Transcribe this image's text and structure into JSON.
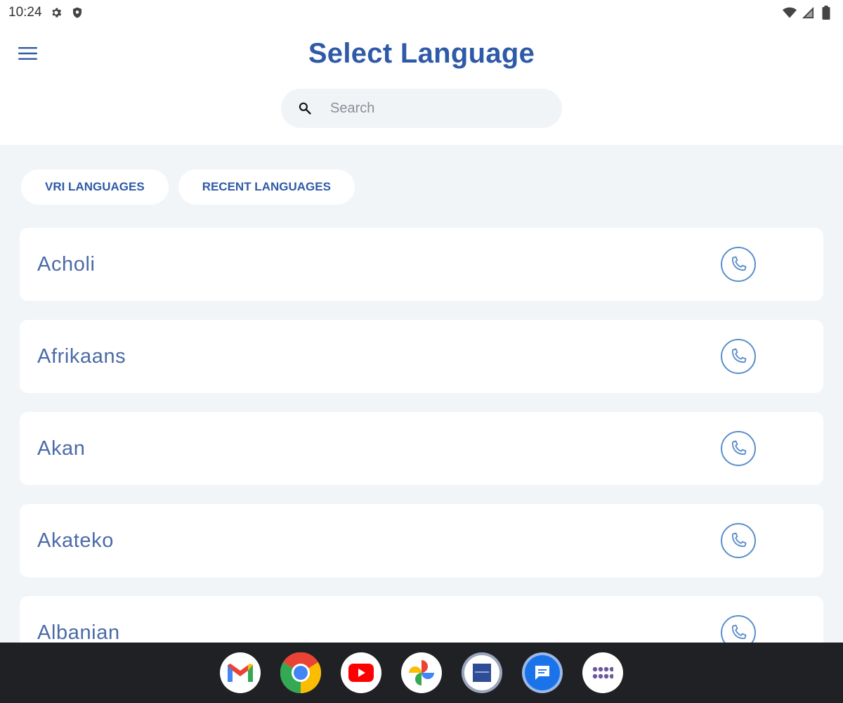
{
  "status_bar": {
    "time": "10:24",
    "icons_left": [
      "gear-icon",
      "shield-icon"
    ],
    "icons_right": [
      "wifi-icon",
      "signal-icon",
      "battery-icon"
    ]
  },
  "header": {
    "title": "Select Language",
    "search_placeholder": "Search"
  },
  "tabs": [
    {
      "label": "VRI LANGUAGES"
    },
    {
      "label": "RECENT LANGUAGES"
    }
  ],
  "languages": [
    {
      "name": "Acholi"
    },
    {
      "name": "Afrikaans"
    },
    {
      "name": "Akan"
    },
    {
      "name": "Akateko"
    },
    {
      "name": "Albanian"
    }
  ],
  "taskbar": {
    "apps": [
      "gmail-icon",
      "chrome-icon",
      "youtube-icon",
      "photos-icon",
      "interpreter-app-icon",
      "messages-icon",
      "app-drawer-icon"
    ]
  },
  "colors": {
    "primary": "#2f5aa8",
    "list_text": "#4a6aa8",
    "call_icon": "#5b8fcb",
    "background": "#f2f5f8",
    "taskbar": "#202124"
  }
}
